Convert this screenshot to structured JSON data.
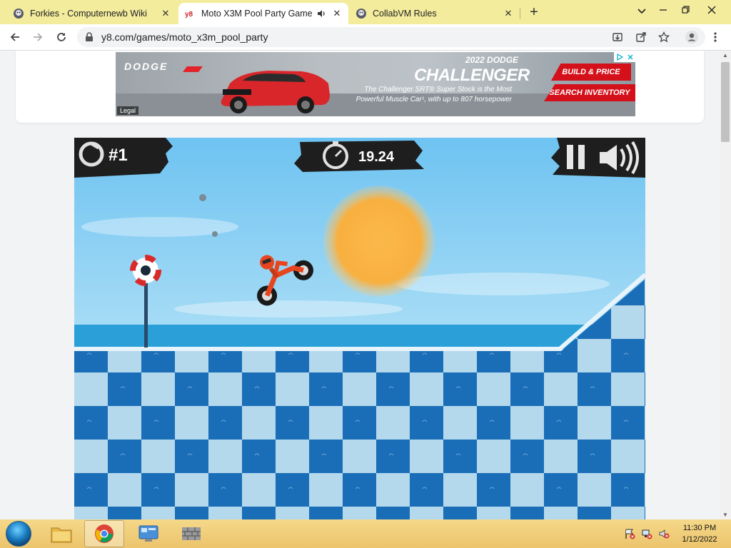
{
  "browser": {
    "tabs": [
      {
        "title": "Forkies - Computernewb Wiki",
        "active": false
      },
      {
        "title": "Moto X3M Pool Party Game",
        "active": true,
        "favicon_text": "y8"
      },
      {
        "title": "CollabVM Rules",
        "active": false
      }
    ],
    "url": "y8.com/games/moto_x3m_pool_party"
  },
  "ad": {
    "brand": "DODGE",
    "year": "2022 DODGE",
    "model": "CHALLENGER",
    "tagline": "The Challenger SRT® Super Stock is the Most Powerful Muscle Car¹, with up to 807 horsepower",
    "cta_primary": "BUILD & PRICE",
    "cta_secondary": "SEARCH INVENTORY",
    "legal": "Legal"
  },
  "game": {
    "rank": "#1",
    "timer": "19.24"
  },
  "taskbar": {
    "time": "11:30 PM",
    "date": "1/12/2022"
  },
  "colors": {
    "tabbar": "#f3ec9c",
    "taskbar": "#ecc46c",
    "sky": "#5bb8ec",
    "water": "#2a9fd8",
    "tile_dark": "#1a6eb8",
    "tile_light": "#b4d8ec",
    "sun": "#f8b040",
    "ad_red": "#d4101a"
  }
}
